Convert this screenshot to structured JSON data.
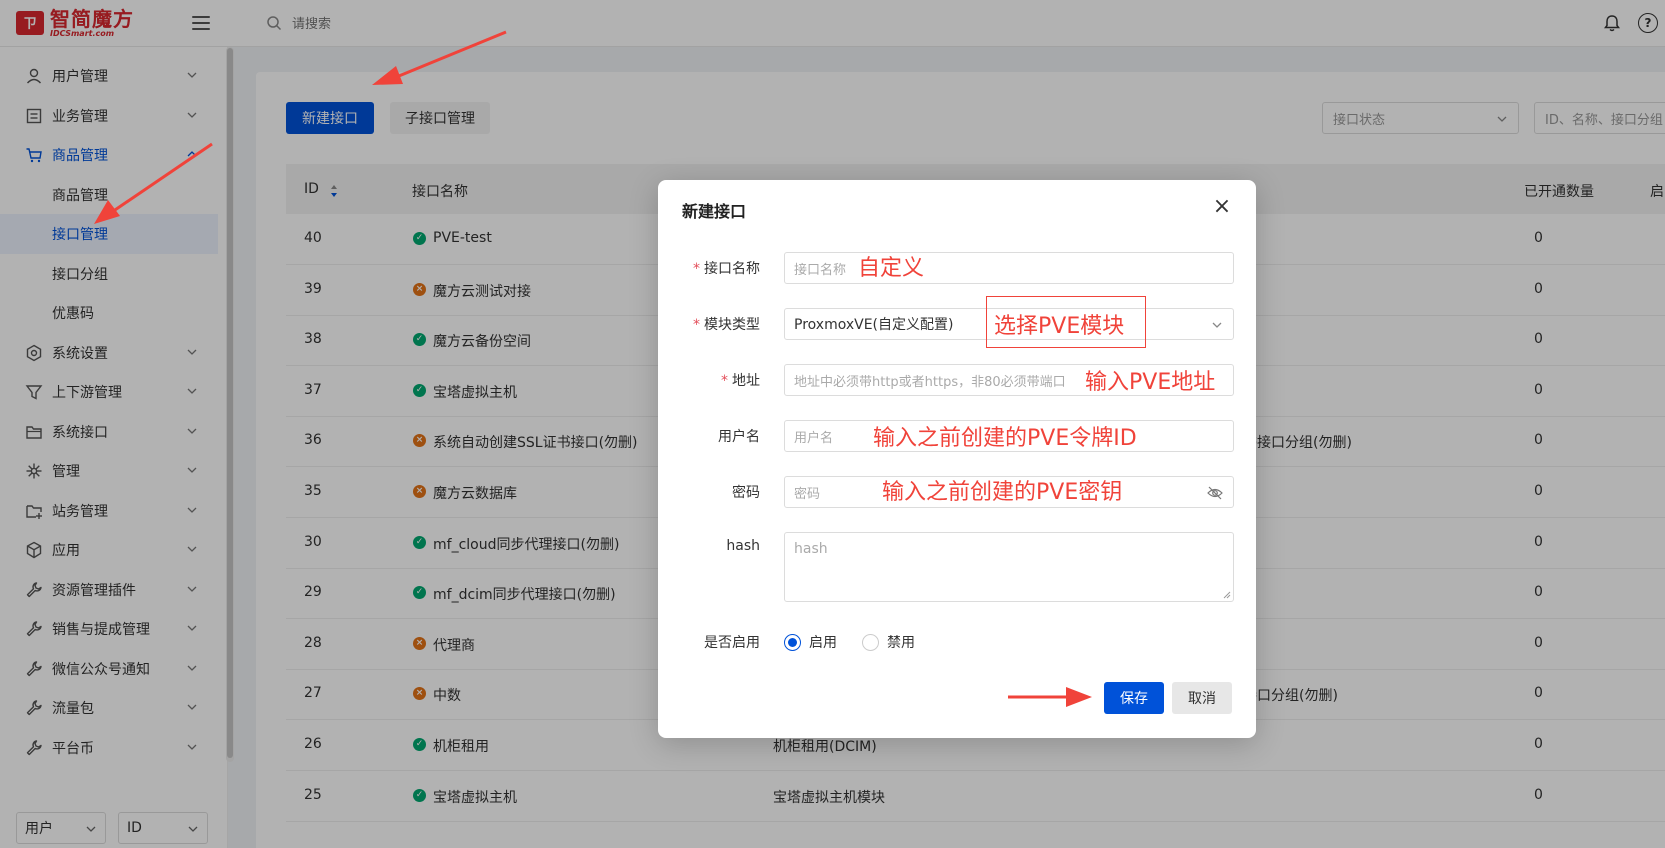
{
  "header": {
    "logo_mark": "ㄗ",
    "logo_text": "智简魔方",
    "logo_sub": "IDCSmart.com",
    "search_placeholder": "请搜索",
    "help_glyph": "?"
  },
  "sidebar": {
    "items": [
      {
        "label": "用户管理",
        "icon": "user-icon",
        "expanded": false
      },
      {
        "label": "业务管理",
        "icon": "list-icon",
        "expanded": false
      },
      {
        "label": "商品管理",
        "icon": "cart-icon",
        "expanded": true
      },
      {
        "label": "系统设置",
        "icon": "gear-icon",
        "expanded": false
      },
      {
        "label": "上下游管理",
        "icon": "filter-icon",
        "expanded": false
      },
      {
        "label": "系统接口",
        "icon": "folder-icon",
        "expanded": false
      },
      {
        "label": "管理",
        "icon": "asterisk-icon",
        "expanded": false
      },
      {
        "label": "站务管理",
        "icon": "folder-add-icon",
        "expanded": false
      },
      {
        "label": "应用",
        "icon": "cube-icon",
        "expanded": false
      },
      {
        "label": "资源管理插件",
        "icon": "wrench-icon",
        "expanded": false
      },
      {
        "label": "销售与提成管理",
        "icon": "wrench-icon",
        "expanded": false
      },
      {
        "label": "微信公众号通知",
        "icon": "wrench-icon",
        "expanded": false
      },
      {
        "label": "流量包",
        "icon": "wrench-icon",
        "expanded": false
      },
      {
        "label": "平台币",
        "icon": "wrench-icon",
        "expanded": false
      }
    ],
    "sub_items": [
      "商品管理",
      "接口管理",
      "接口分组",
      "优惠码"
    ],
    "active_sub": "接口管理",
    "bottom_select_1": "用户",
    "bottom_select_2": "ID"
  },
  "toolbar": {
    "new_button": "新建接口",
    "sub_button": "子接口管理",
    "status_placeholder": "接口状态",
    "filter_placeholder": "ID、名称、接口分组"
  },
  "table": {
    "columns": [
      "ID",
      "接口名称",
      "已开通数量",
      "启"
    ],
    "rows": [
      {
        "id": "40",
        "name": "PVE-test",
        "status": "ok",
        "extra": "",
        "count": "0"
      },
      {
        "id": "39",
        "name": "魔方云测试对接",
        "status": "err",
        "extra": "",
        "count": "0"
      },
      {
        "id": "38",
        "name": "魔方云备份空间",
        "status": "ok",
        "extra": "",
        "count": "0"
      },
      {
        "id": "37",
        "name": "宝塔虚拟主机",
        "status": "ok",
        "extra": "",
        "count": "0"
      },
      {
        "id": "36",
        "name": "系统自动创建SSL证书接口(勿删)",
        "status": "err",
        "extra": "书接口分组(勿删)",
        "count": "0"
      },
      {
        "id": "35",
        "name": "魔方云数据库",
        "status": "err",
        "extra": "",
        "count": "0"
      },
      {
        "id": "30",
        "name": "mf_cloud同步代理接口(勿删)",
        "status": "ok",
        "extra": "",
        "count": "0"
      },
      {
        "id": "29",
        "name": "mf_dcim同步代理接口(勿删)",
        "status": "ok",
        "extra": "",
        "count": "0"
      },
      {
        "id": "28",
        "name": "代理商",
        "status": "err",
        "extra": "",
        "count": "0"
      },
      {
        "id": "27",
        "name": "中数",
        "status": "err",
        "extra": "接口分组(勿删)",
        "count": "0"
      },
      {
        "id": "26",
        "name": "机柜租用",
        "status": "ok",
        "extra": "机柜租用(DCIM)",
        "count": "0"
      },
      {
        "id": "25",
        "name": "宝塔虚拟主机",
        "status": "ok",
        "extra": "宝塔虚拟主机模块",
        "count": "0"
      }
    ]
  },
  "dialog": {
    "title": "新建接口",
    "close_glyph": "×",
    "fields": {
      "name_label": "接口名称",
      "name_placeholder": "接口名称",
      "module_label": "模块类型",
      "module_value": "ProxmoxVE(自定义配置)",
      "address_label": "地址",
      "address_placeholder": "地址中必须带http或者https，非80必须带端口",
      "username_label": "用户名",
      "username_placeholder": "用户名",
      "password_label": "密码",
      "password_placeholder": "密码",
      "hash_label": "hash",
      "hash_placeholder": "hash",
      "enable_label": "是否启用",
      "enable_on": "启用",
      "enable_off": "禁用",
      "enabled": true
    },
    "save_button": "保存",
    "cancel_button": "取消"
  },
  "annotations": {
    "name_hint": "自定义",
    "module_hint": "选择PVE模块",
    "address_hint": "输入PVE地址",
    "username_hint": "输入之前创建的PVE令牌ID",
    "password_hint": "输入之前创建的PVE密钥",
    "color": "#f0433a"
  },
  "colors": {
    "primary": "#0052d9",
    "ok": "#00a870",
    "error": "#e37318",
    "brand": "#d8282f"
  }
}
